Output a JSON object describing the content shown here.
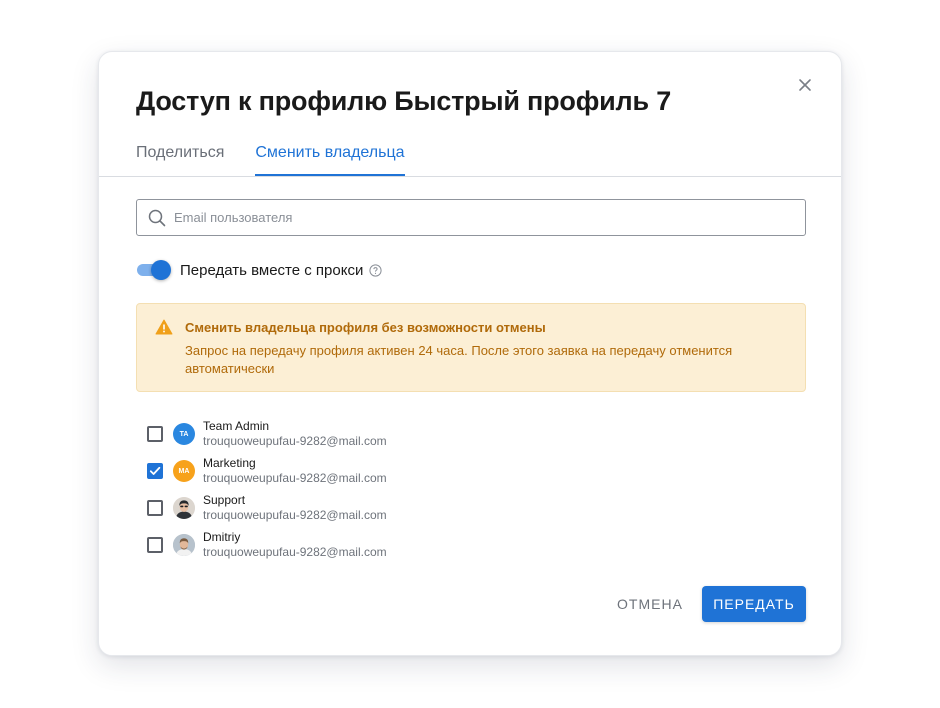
{
  "dialog": {
    "title": "Доступ к профилю Быстрый профиль 7",
    "close_icon": "close-icon"
  },
  "tabs": [
    {
      "label": "Поделиться",
      "active": false
    },
    {
      "label": "Сменить владельца",
      "active": true
    }
  ],
  "search": {
    "placeholder": "Email пользователя",
    "value": "",
    "icon": "search-icon"
  },
  "proxy_toggle": {
    "label": "Передать вместе с прокси",
    "on": true,
    "help_icon": "question-circle-icon"
  },
  "alert": {
    "icon": "warning-triangle-icon",
    "title": "Сменить владельца профиля без возможности отмены",
    "text": "Запрос на передачу профиля активен 24 часа. После этого заявка на передачу отменится автоматически"
  },
  "users": [
    {
      "name": "Team Admin",
      "email": "trouquoweupufau-9282@mail.com",
      "checked": false,
      "avatar_initials": "TA",
      "avatar_color": "#2a87e0"
    },
    {
      "name": "Marketing",
      "email": "trouquoweupufau-9282@mail.com",
      "checked": true,
      "avatar_initials": "MA",
      "avatar_color": "#f7a21b"
    },
    {
      "name": "Support",
      "email": "trouquoweupufau-9282@mail.com",
      "checked": false,
      "avatar_initials": "",
      "avatar_color": "#3a3f46"
    },
    {
      "name": "Dmitriy",
      "email": "trouquoweupufau-9282@mail.com",
      "checked": false,
      "avatar_initials": "",
      "avatar_color": "#8c9aa8"
    }
  ],
  "actions": {
    "cancel_label": "ОТМЕНА",
    "submit_label": "ПЕРЕДАТЬ"
  },
  "colors": {
    "accent": "#1f73d6",
    "warning_bg": "#fcefd5",
    "warning_text": "#b06a0a"
  }
}
